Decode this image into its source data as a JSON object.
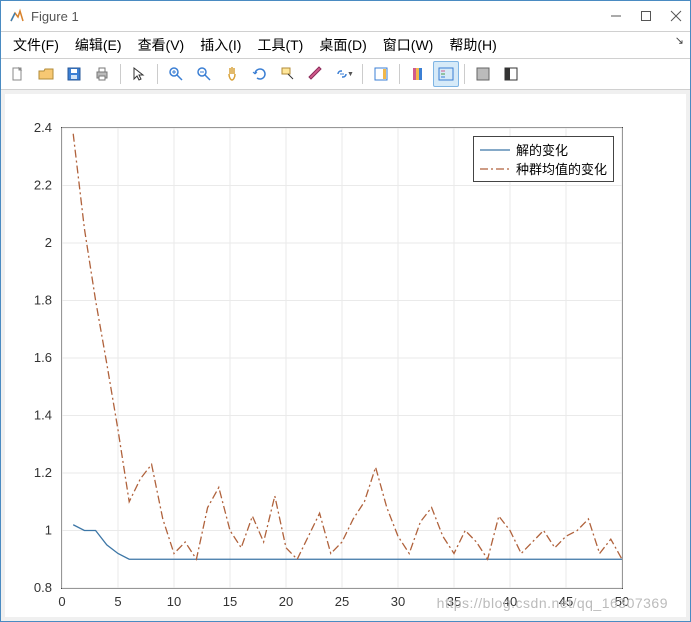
{
  "window": {
    "title": "Figure 1"
  },
  "menus": [
    "文件(F)",
    "编辑(E)",
    "查看(V)",
    "插入(I)",
    "工具(T)",
    "桌面(D)",
    "窗口(W)",
    "帮助(H)"
  ],
  "toolbar_icons": [
    "new-file-icon",
    "open-folder-icon",
    "save-icon",
    "print-icon",
    "pointer-icon",
    "zoom-in-icon",
    "zoom-out-icon",
    "pan-icon",
    "rotate-icon",
    "data-cursor-icon",
    "brush-icon",
    "link-icon",
    "colorbar-icon",
    "colormap-icon",
    "legend-icon",
    "subplot-icon",
    "dock-icon"
  ],
  "watermark": "https://blog.csdn.net/qq_16307369",
  "chart_data": {
    "type": "line",
    "xlabel": "",
    "ylabel": "",
    "xlim": [
      0,
      50
    ],
    "ylim": [
      0.8,
      2.4
    ],
    "xticks": [
      0,
      5,
      10,
      15,
      20,
      25,
      30,
      35,
      40,
      45,
      50
    ],
    "yticks": [
      0.8,
      1.0,
      1.2,
      1.4,
      1.6,
      1.8,
      2.0,
      2.2,
      2.4
    ],
    "legend": [
      "解的变化",
      "种群均值的变化"
    ],
    "legend_pos": "northeast",
    "series": [
      {
        "name": "解的变化",
        "color": "#3c76a6",
        "style": "solid",
        "x": [
          1,
          2,
          3,
          4,
          5,
          6,
          7,
          8,
          9,
          10,
          11,
          12,
          13,
          14,
          15,
          16,
          17,
          18,
          19,
          20,
          21,
          22,
          23,
          24,
          25,
          26,
          27,
          28,
          29,
          30,
          31,
          32,
          33,
          34,
          35,
          36,
          37,
          38,
          39,
          40,
          41,
          42,
          43,
          44,
          45,
          46,
          47,
          48,
          49,
          50
        ],
        "y": [
          1.02,
          1.0,
          1.0,
          0.95,
          0.92,
          0.9,
          0.9,
          0.9,
          0.9,
          0.9,
          0.9,
          0.9,
          0.9,
          0.9,
          0.9,
          0.9,
          0.9,
          0.9,
          0.9,
          0.9,
          0.9,
          0.9,
          0.9,
          0.9,
          0.9,
          0.9,
          0.9,
          0.9,
          0.9,
          0.9,
          0.9,
          0.9,
          0.9,
          0.9,
          0.9,
          0.9,
          0.9,
          0.9,
          0.9,
          0.9,
          0.9,
          0.9,
          0.9,
          0.9,
          0.9,
          0.9,
          0.9,
          0.9,
          0.9,
          0.9
        ]
      },
      {
        "name": "种群均值的变化",
        "color": "#b0623c",
        "style": "dashdot",
        "x": [
          1,
          2,
          3,
          4,
          5,
          6,
          7,
          8,
          9,
          10,
          11,
          12,
          13,
          14,
          15,
          16,
          17,
          18,
          19,
          20,
          21,
          22,
          23,
          24,
          25,
          26,
          27,
          28,
          29,
          30,
          31,
          32,
          33,
          34,
          35,
          36,
          37,
          38,
          39,
          40,
          41,
          42,
          43,
          44,
          45,
          46,
          47,
          48,
          49,
          50
        ],
        "y": [
          2.38,
          2.05,
          1.8,
          1.58,
          1.35,
          1.1,
          1.18,
          1.23,
          1.04,
          0.92,
          0.96,
          0.9,
          1.08,
          1.15,
          1.0,
          0.94,
          1.05,
          0.96,
          1.12,
          0.94,
          0.9,
          0.98,
          1.06,
          0.92,
          0.96,
          1.04,
          1.1,
          1.22,
          1.08,
          0.98,
          0.92,
          1.03,
          1.08,
          0.98,
          0.92,
          1.0,
          0.96,
          0.9,
          1.05,
          1.0,
          0.92,
          0.96,
          1.0,
          0.94,
          0.98,
          1.0,
          1.04,
          0.92,
          0.97,
          0.9
        ]
      }
    ]
  }
}
